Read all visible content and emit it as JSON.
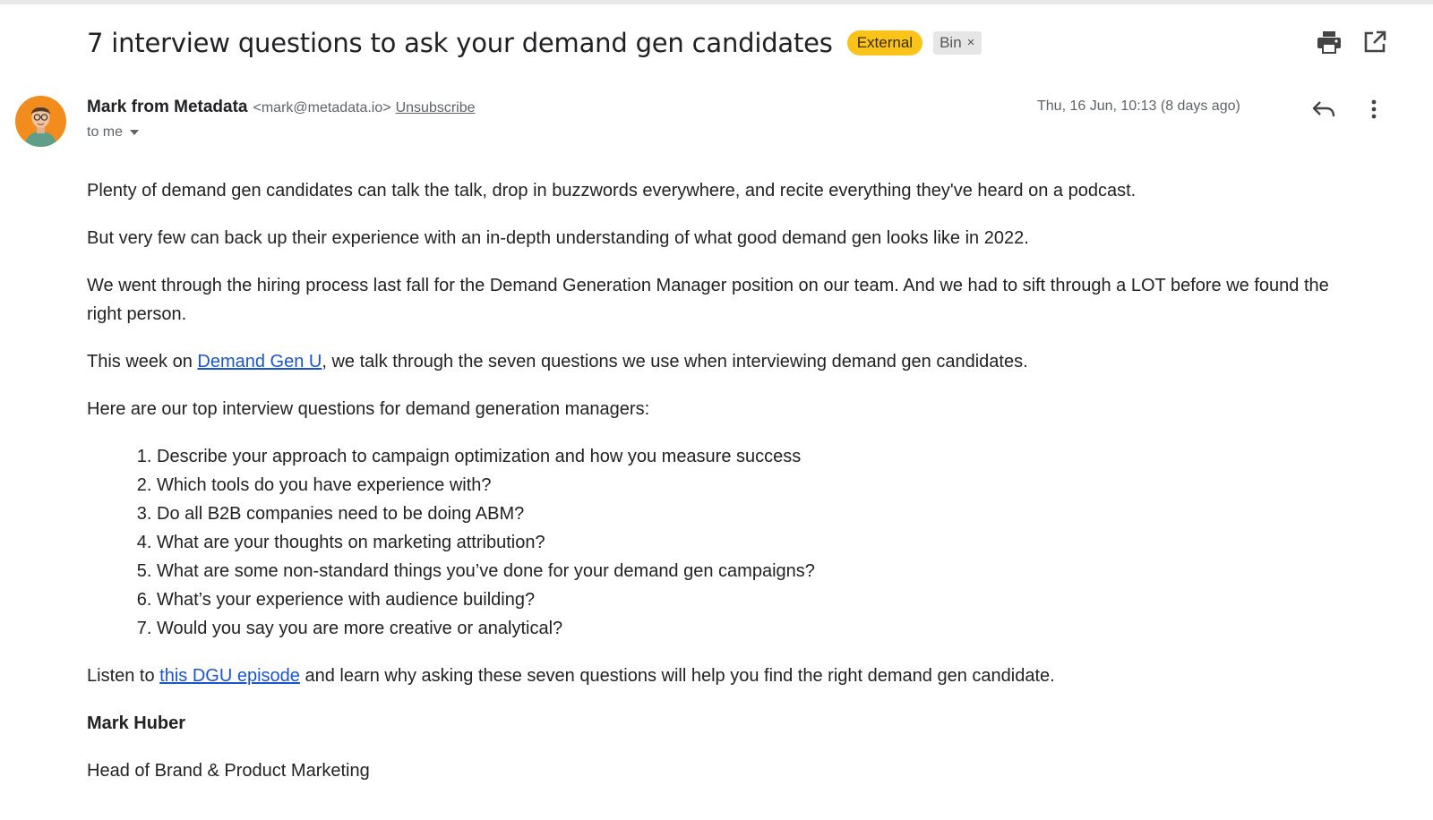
{
  "subject": {
    "title": "7 interview questions to ask your demand gen candidates",
    "labels": {
      "external": "External",
      "bin": "Bin",
      "bin_remove": "×"
    }
  },
  "toolbar": {
    "print_icon": "print-icon",
    "popout_icon": "open-in-new-window-icon"
  },
  "sender": {
    "name": "Mark from Metadata",
    "email": "<mark@metadata.io>",
    "unsubscribe": "Unsubscribe",
    "to": "to me",
    "date": "Thu, 16 Jun, 10:13 (8 days ago)",
    "avatar_bg": "#f28c1c"
  },
  "actions": {
    "reply_icon": "reply-icon",
    "more_icon": "more-vertical-icon"
  },
  "message": {
    "p1": "Plenty of demand gen candidates can talk the talk, drop in buzzwords everywhere, and recite everything they've heard on a podcast.",
    "p2": "But very few can back up their experience with an in-depth understanding of what good demand gen looks like in 2022.",
    "p3": "We went through the hiring process last fall for the Demand Generation Manager position on our team. And we had to sift through a LOT before we found the right person.",
    "p4_before": "This week on ",
    "p4_link": "Demand Gen U",
    "p4_after": ", we talk through the seven questions we use when interviewing demand gen candidates.",
    "p5": "Here are our top interview questions for demand generation managers:",
    "questions": [
      "Describe your approach to campaign optimization and how you measure success",
      "Which tools do you have experience with?",
      "Do all B2B companies need to be doing ABM?",
      "What are your thoughts on marketing attribution?",
      "What are some non-standard things you’ve done for your demand gen campaigns?",
      "What’s your experience with audience building?",
      "Would you say you are more creative or analytical?"
    ],
    "p6_before": "Listen to ",
    "p6_link": "this DGU episode",
    "p6_after": " and learn why asking these seven questions will help you find the right demand gen candidate.",
    "signature_name": "Mark Huber",
    "signature_title": "Head of Brand & Product Marketing"
  },
  "colors": {
    "external_label": "#f9c31a",
    "link": "#1a55cc",
    "muted_text": "#5f6368"
  }
}
